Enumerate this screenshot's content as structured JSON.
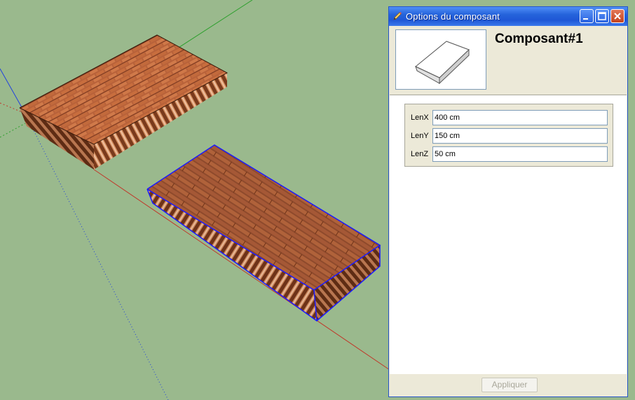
{
  "window": {
    "title": "Options du composant",
    "component_name": "Composant#1"
  },
  "fields": [
    {
      "label": "LenX",
      "value": "400 cm"
    },
    {
      "label": "LenY",
      "value": "150 cm"
    },
    {
      "label": "LenZ",
      "value": "50 cm"
    }
  ],
  "footer": {
    "apply_label": "Appliquer"
  },
  "colors": {
    "ground": "#9ab98d",
    "axis_red": "#c0392b",
    "axis_green": "#2ea02e",
    "axis_blue": "#1f3fe0",
    "selection": "#1a1aff",
    "brick": "#a0522d"
  },
  "icons": [
    "pencil-icon",
    "minimize-icon",
    "maximize-icon",
    "close-icon"
  ]
}
